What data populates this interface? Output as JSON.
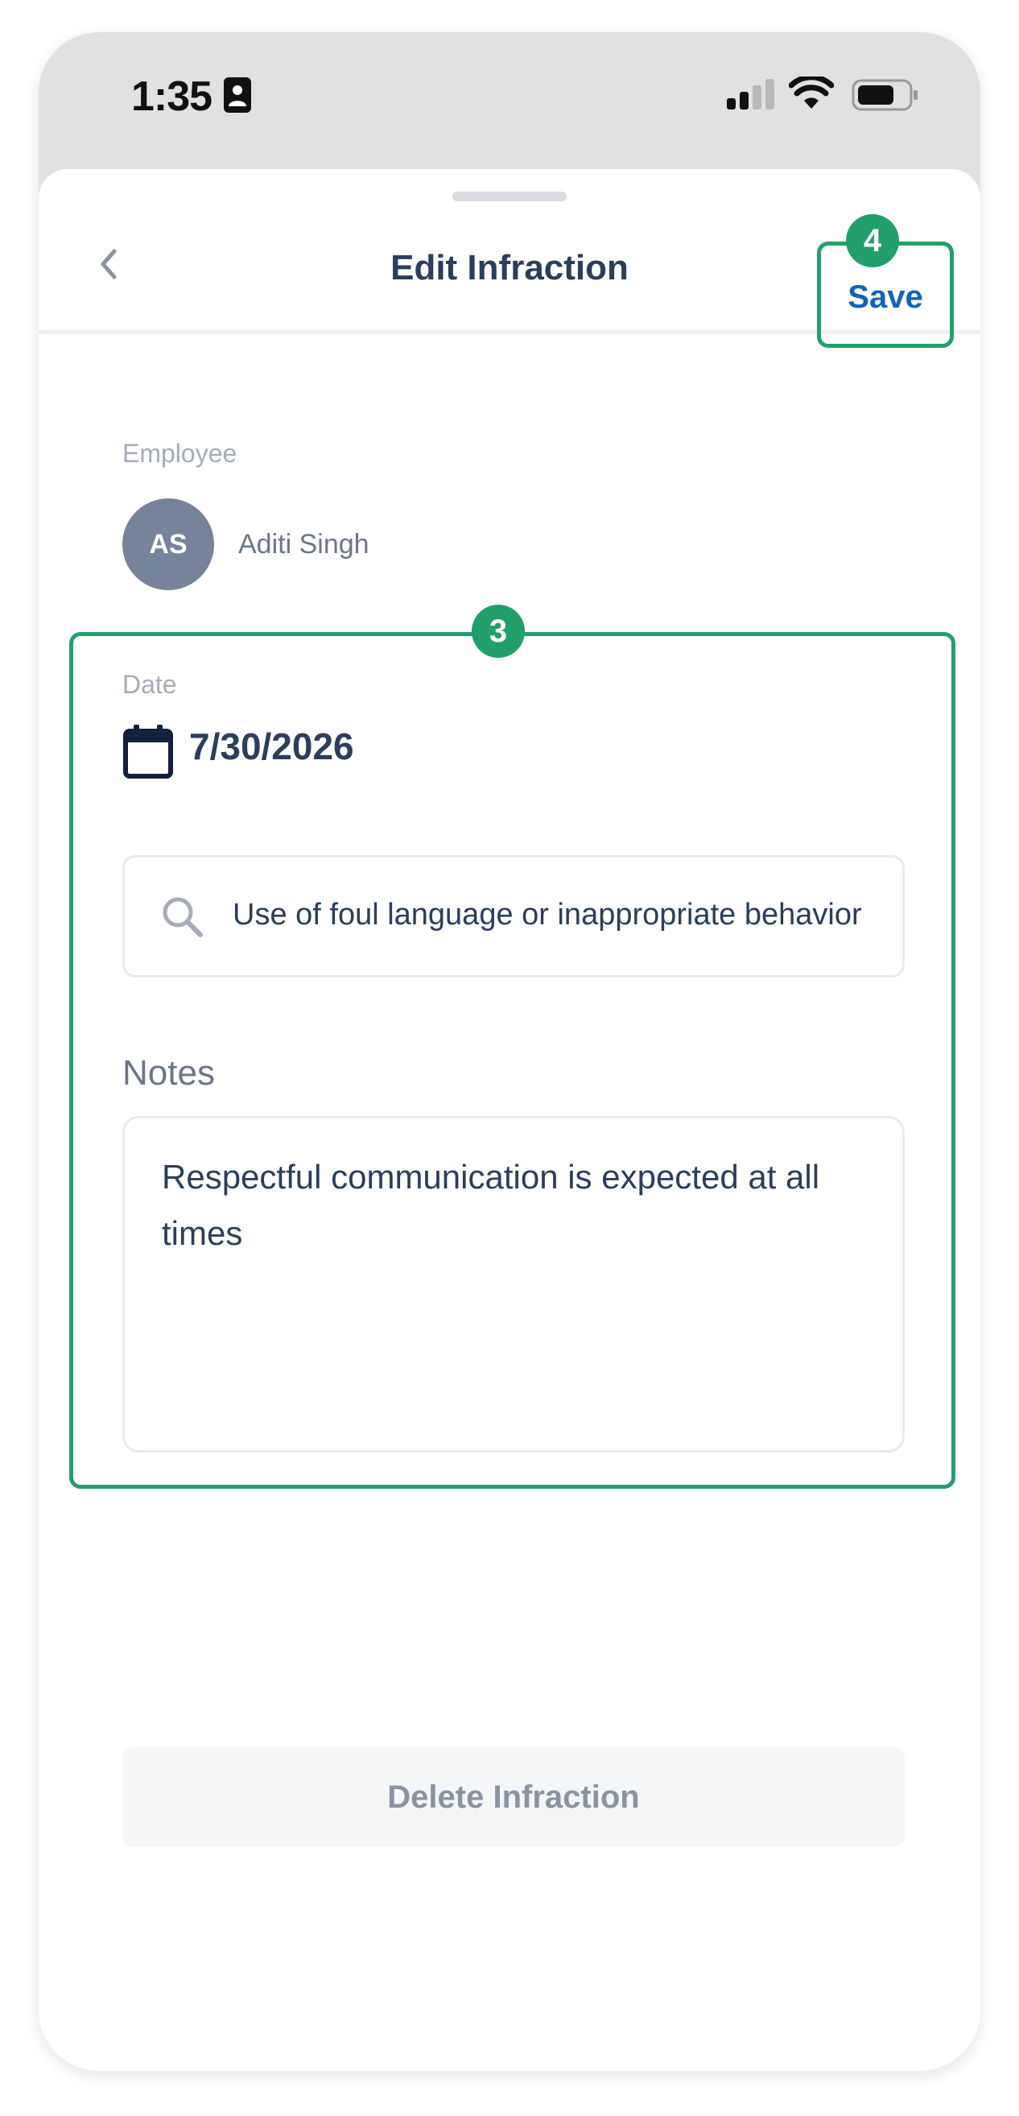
{
  "status_bar": {
    "time": "1:35",
    "icons": [
      "sim-card-icon",
      "cellular-signal-icon",
      "wifi-icon",
      "battery-icon"
    ]
  },
  "nav": {
    "title": "Edit Infraction",
    "back_icon": "chevron-left-icon",
    "save_label": "Save"
  },
  "annotations": {
    "step_3": "3",
    "step_4": "4",
    "highlight_color": "#22a06b"
  },
  "employee": {
    "label": "Employee",
    "initials": "AS",
    "name": "Aditi Singh"
  },
  "date": {
    "label": "Date",
    "value": "7/30/2026",
    "icon": "calendar-icon"
  },
  "infraction_search": {
    "value": "Use of foul language or inappropriate behavior",
    "icon": "search-icon"
  },
  "notes": {
    "label": "Notes",
    "value": "Respectful communication is expected at all times"
  },
  "delete_label": "Delete Infraction",
  "colors": {
    "accent": "#1264b8",
    "title": "#2c3e5c",
    "avatar": "#77839a",
    "highlight": "#22a06b"
  }
}
